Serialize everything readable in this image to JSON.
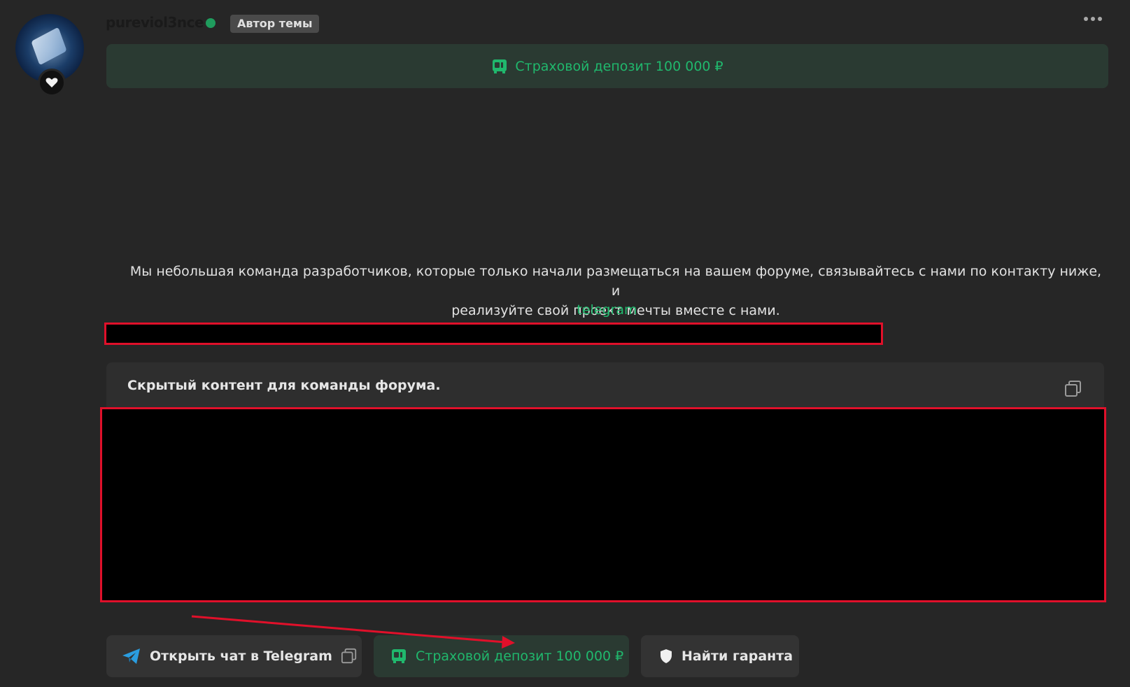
{
  "post": {
    "username": "pureviol3nce",
    "author_badge": "Автор темы",
    "deposit_banner": "Страховой депозит 100 000 ₽",
    "message_line1": "Мы небольшая команда разработчиков, которые только начали размещаться на вашем форуме, связывайтесь с нами по контакту ниже, и",
    "message_line2": "реализуйте свой проект мечты вместе с нами.",
    "telegram_link": "telegram",
    "hidden_title": "Скрытый контент для команды форума."
  },
  "buttons": {
    "telegram": "Открыть чат в Telegram",
    "deposit": "Страховой депозит 100 000 ₽",
    "guarantor": "Найти гаранта"
  },
  "colors": {
    "accent_green": "#20b86d",
    "annotation_red": "#e0102a",
    "background": "#262626"
  },
  "icons": {
    "online_status": "online-dot",
    "deposit": "deposit-icon",
    "telegram": "telegram-icon",
    "copy": "copy-icon",
    "shield": "shield-icon",
    "heart": "heart-icon",
    "more": "more-icon"
  }
}
